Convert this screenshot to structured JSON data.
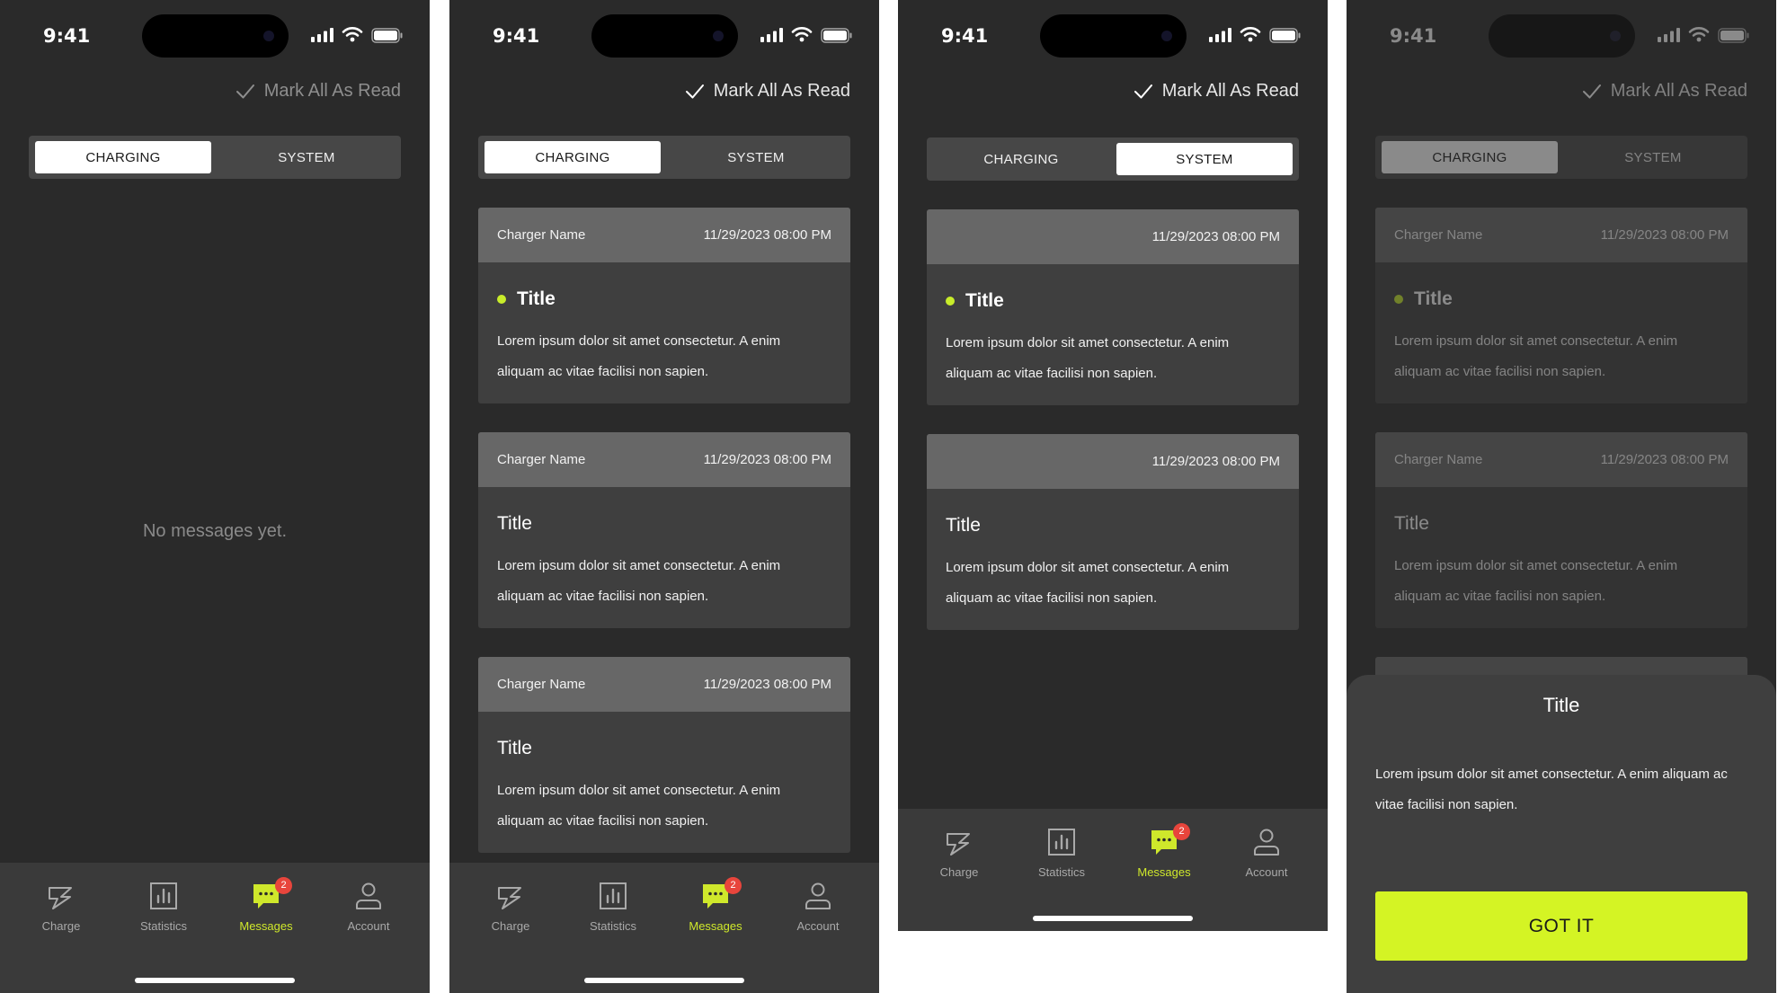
{
  "status": {
    "time": "9:41"
  },
  "header": {
    "mark_all": "Mark All As Read"
  },
  "segments": {
    "charging": "CHARGING",
    "system": "SYSTEM"
  },
  "empty_state": "No messages yet.",
  "card": {
    "charger_name": "Charger Name",
    "datetime": "11/29/2023 08:00 PM",
    "title": "Title",
    "body": "Lorem ipsum dolor sit amet consectetur. A enim aliquam ac vitae facilisi non sapien."
  },
  "tabs": {
    "charge": "Charge",
    "statistics": "Statistics",
    "messages": "Messages",
    "account": "Account",
    "messages_badge": "2"
  },
  "sheet": {
    "title": "Title",
    "body": "Lorem ipsum dolor sit amet consectetur. A enim aliquam ac vitae facilisi non sapien.",
    "button": "GOT IT"
  },
  "colors": {
    "accent": "#d4f424",
    "unread_dot": "#c8ec2a",
    "badge": "#e8453c",
    "background": "#2a2a2a",
    "card": "#3f3f3f",
    "card_header": "#676767"
  },
  "icons": [
    "signal-icon",
    "wifi-icon",
    "battery-icon",
    "check-icon",
    "bolt-icon",
    "bar-chart-icon",
    "chat-bubble-icon",
    "user-icon"
  ]
}
